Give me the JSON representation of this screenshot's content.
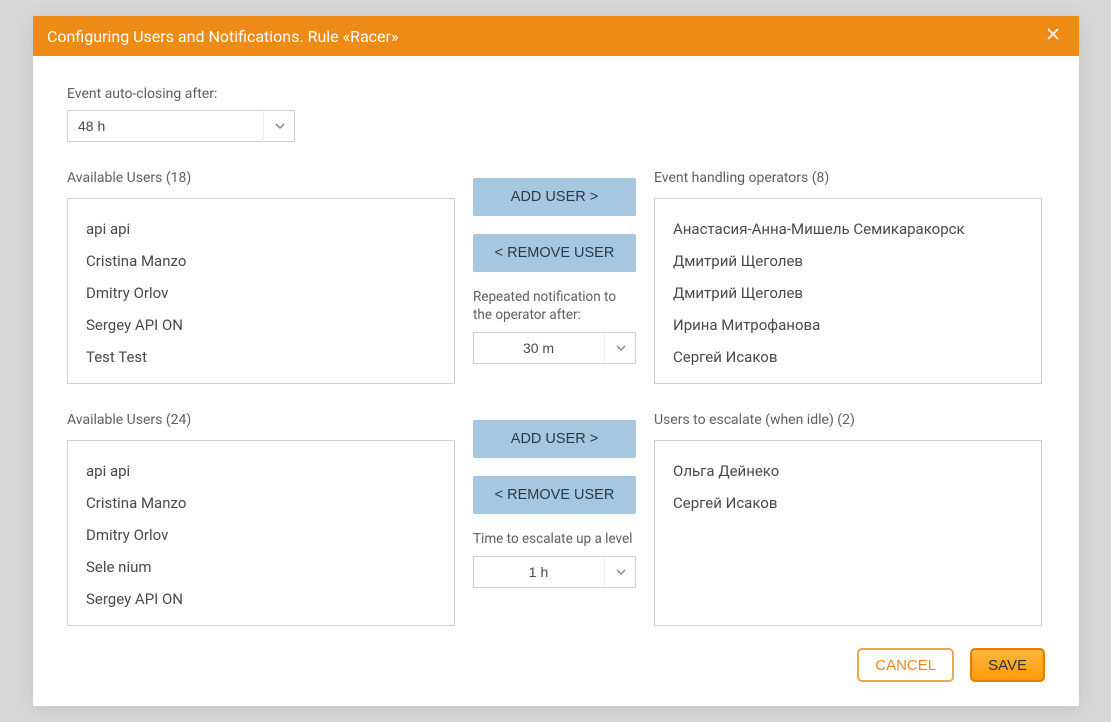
{
  "title": "Configuring Users and Notifications. Rule «Racer»",
  "autoClose": {
    "label": "Event auto-closing after:",
    "value": "48 h"
  },
  "section1": {
    "left": {
      "label": "Available Users (18)",
      "items": [
        "api api",
        "Cristina Manzo",
        "Dmitry Orlov",
        "Sergey API ON",
        "Test Test"
      ]
    },
    "mid": {
      "addLabel": "ADD USER >",
      "removeLabel": "< REMOVE USER",
      "fieldLabel": "Repeated notification to the operator after:",
      "fieldValue": "30 m"
    },
    "right": {
      "label": "Event handling operators (8)",
      "items": [
        "Анастасия-Анна-Мишель Семикаракорск",
        "Дмитрий Щеголев",
        "Дмитрий Щеголев",
        "Ирина Митрофанова",
        "Сергей Исаков"
      ]
    }
  },
  "section2": {
    "left": {
      "label": "Available Users (24)",
      "items": [
        "api api",
        "Cristina Manzo",
        "Dmitry Orlov",
        "Sele nium",
        "Sergey API ON"
      ]
    },
    "mid": {
      "addLabel": "ADD USER >",
      "removeLabel": "< REMOVE USER",
      "fieldLabel": "Time to escalate up a level",
      "fieldValue": "1 h"
    },
    "right": {
      "label": "Users to escalate (when idle) (2)",
      "items": [
        "Ольга Дейнеко",
        "Сергей Исаков"
      ]
    }
  },
  "footer": {
    "cancel": "CANCEL",
    "save": "SAVE"
  }
}
